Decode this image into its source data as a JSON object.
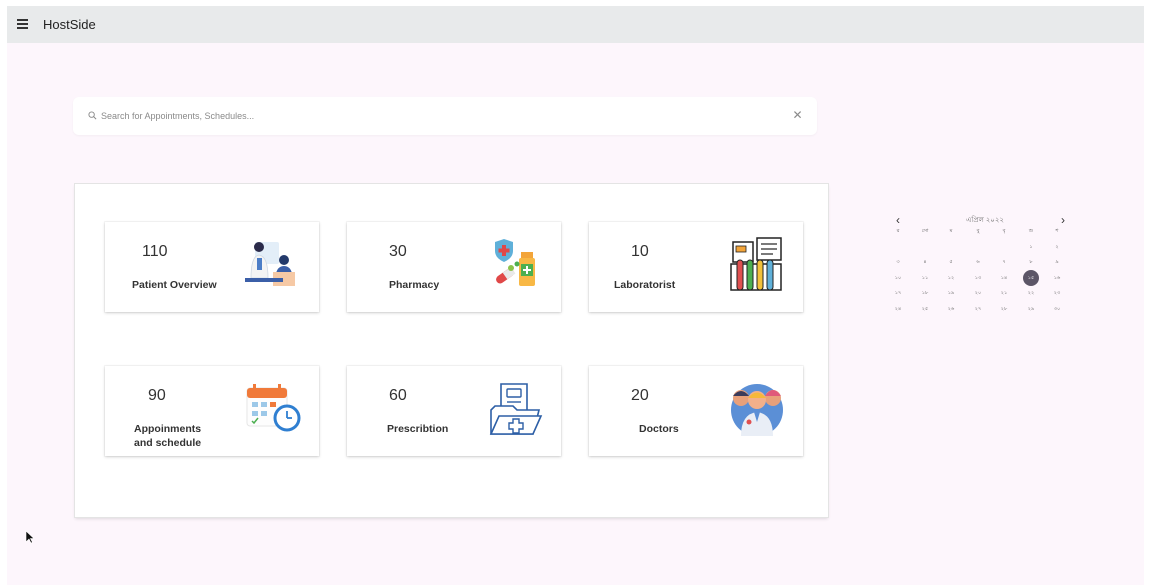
{
  "app": {
    "title": "HostSide"
  },
  "search": {
    "placeholder": "Search for Appointments, Schedules...",
    "value": ""
  },
  "cards": [
    {
      "id": "patient-overview",
      "count": "110",
      "label": "Patient Overview",
      "icon": "patient-doctor-icon"
    },
    {
      "id": "pharmacy",
      "count": "30",
      "label": "Pharmacy",
      "icon": "medicine-icon"
    },
    {
      "id": "laboratorist",
      "count": "10",
      "label": "Laboratorist",
      "icon": "lab-test-tubes-icon"
    },
    {
      "id": "appointments",
      "count": "90",
      "label": "Appoinments\nand schedule",
      "label_lines": [
        "Appoinments",
        "and schedule"
      ],
      "icon": "calendar-clock-icon"
    },
    {
      "id": "prescription",
      "count": "60",
      "label": "Prescribtion",
      "icon": "prescription-folder-icon"
    },
    {
      "id": "doctors",
      "count": "20",
      "label": "Doctors",
      "icon": "doctors-group-icon"
    }
  ],
  "calendar": {
    "month_label": "এপ্রিল ২০২২",
    "prev_icon": "chevron-left-icon",
    "next_icon": "chevron-right-icon",
    "selected_day": "১৫",
    "rows": [
      [
        "র",
        "সো",
        "ম",
        "বু",
        "বৃ",
        "শু",
        "শ"
      ],
      [
        "",
        "",
        "",
        "",
        "",
        "১",
        "২"
      ],
      [
        "৩",
        "৪",
        "৫",
        "৬",
        "৭",
        "৮",
        "৯"
      ],
      [
        "১০",
        "১১",
        "১২",
        "১৩",
        "১৪",
        "১৫",
        "১৬"
      ],
      [
        "১৭",
        "১৮",
        "১৯",
        "২০",
        "২১",
        "২২",
        "২৩"
      ],
      [
        "২৪",
        "২৫",
        "২৬",
        "২৭",
        "২৮",
        "২৯",
        "৩০"
      ]
    ]
  },
  "colors": {
    "topbar": "#e8eaeb",
    "background": "#fdf6fc",
    "selected_day": "#5c5667"
  }
}
